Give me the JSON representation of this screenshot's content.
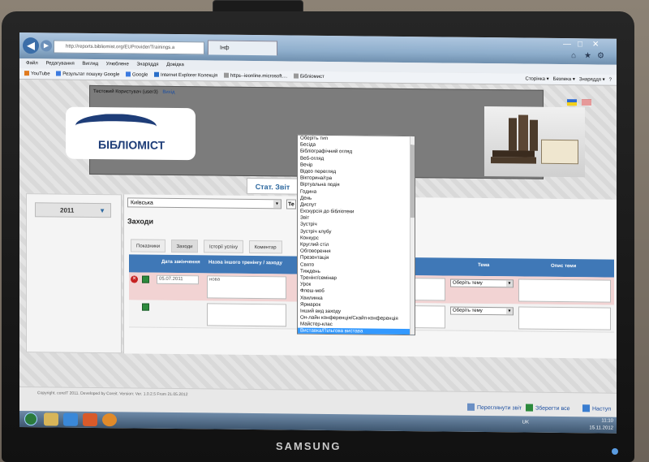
{
  "browser": {
    "address": "http://reports.bibliomist.org/EUProvider/Trainings.a",
    "tab_title": "Інф",
    "menu": [
      "Файл",
      "Редагування",
      "Вигляд",
      "Улюблене",
      "Знаряддя",
      "Довідка"
    ],
    "favorites": [
      "YouTube",
      "Результат пошуку Google",
      "Google",
      "Internet Explorer Колекція",
      "https--ieonline.microsoft....",
      "Бібліомист"
    ],
    "commands": [
      "Сторінка",
      "Безпека",
      "Знаряддя"
    ]
  },
  "header": {
    "user_name": "Тестовий Користувач (user3)",
    "logout": "Вихід",
    "logo_text": "БІБЛІОМІСТ"
  },
  "stat_button": "Стат. Звіт",
  "sidebar": {
    "year": "2011"
  },
  "main": {
    "region": "Київська",
    "region2": "Те",
    "section_title": "Заходи",
    "tabs": [
      "Показники",
      "Заходи",
      "Історії успіху",
      "Коментар"
    ]
  },
  "grid": {
    "columns": [
      "Дата закінчення",
      "Назва іншого тренінгу / заходу",
      "Тема",
      "Опис теми"
    ],
    "row1": {
      "date": "05.07.2011",
      "name": "нова",
      "type": "Оберіть тип",
      "topic": "Оберіть тему"
    },
    "row2": {
      "type": "Оберіть тип",
      "topic": "Оберіть тему"
    }
  },
  "dropdown": {
    "items": [
      "Оберіть тип",
      "Бесіда",
      "Бібліографічний огляд",
      "Веб-огляд",
      "Вечір",
      "Відео перегляд",
      "Вікторина/гра",
      "Віртуальна подія",
      "Година",
      "День",
      "Диспут",
      "Екскурсія до бібліотеки",
      "Звіт",
      "Зустріч",
      "Зустріч клубу",
      "Конкурс",
      "Круглий стіл",
      "Обговорення",
      "Презентація",
      "Свято",
      "Тиждень",
      "Тренінг/семінар",
      "Урок",
      "Флеш-моб",
      "Хвилинка",
      "Ярмарок",
      "Інший вид заходу",
      "Он-лайн конференція/Скайп-конференція",
      "Майстер-клас",
      "Виставка/Пільгова вистава"
    ],
    "highlighted_index": 29
  },
  "footer": {
    "copyright": "Copyright. coreIT 2011. Developed by Coreit. Version: Ver. 1.0.2.5 From 21.05.2012",
    "view_report": "Переглянути звіт",
    "save_all": "Зберегти все",
    "next": "Наступ"
  },
  "taskbar": {
    "lang": "UK",
    "time": "11:10",
    "date": "15.11.2012"
  },
  "monitor_brand": "SAMSUNG"
}
